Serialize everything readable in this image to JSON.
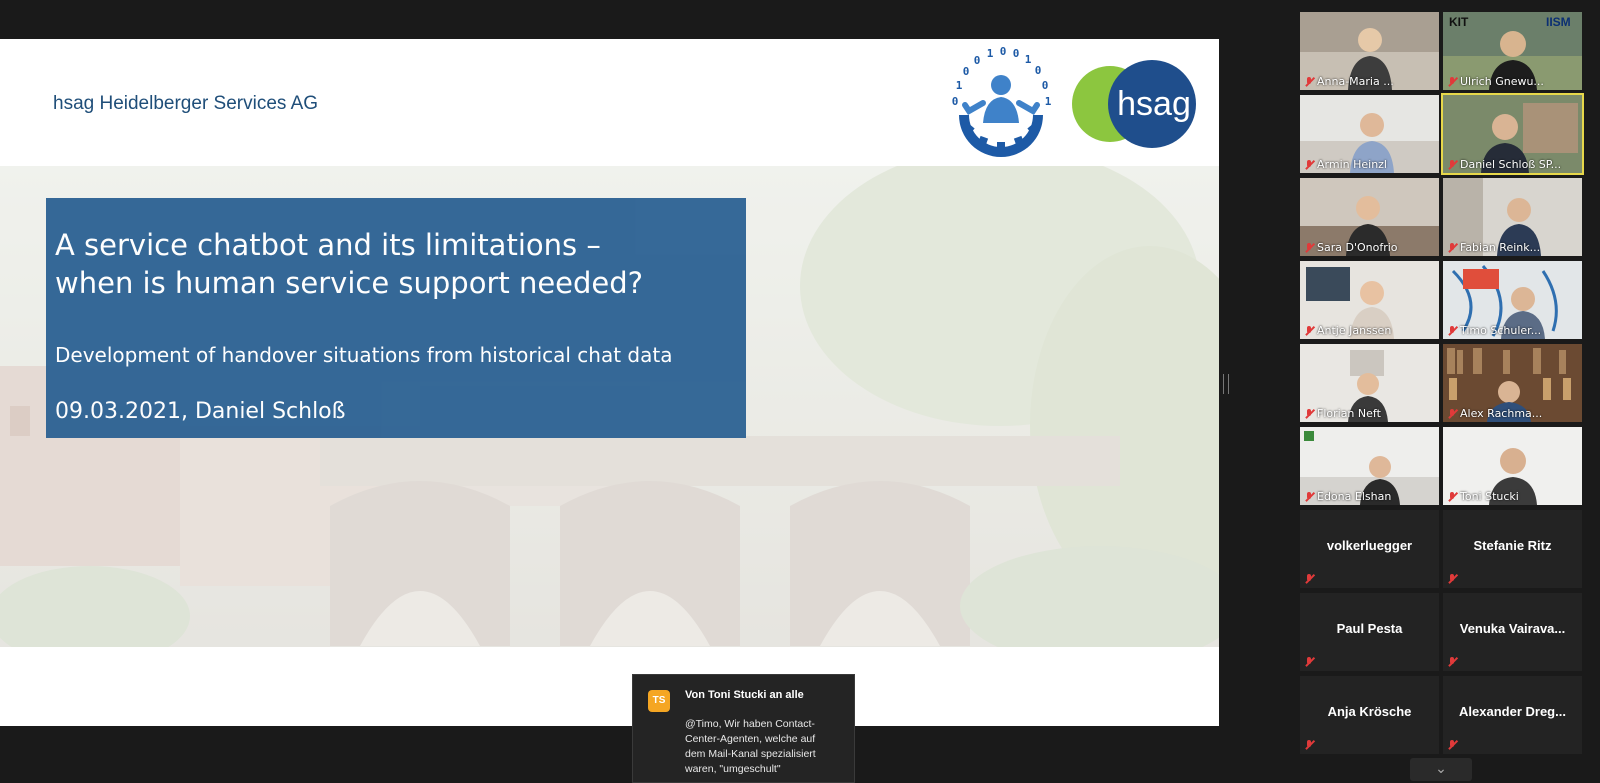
{
  "slide": {
    "company": "hsag Heidelberger Services AG",
    "logo_text": "hsag",
    "title_line1": "A service chatbot and its limitations –",
    "title_line2": "when is human service support needed?",
    "subtitle": "Development of handover situations from historical chat data",
    "date_presenter": "09.03.2021, Daniel Schloß"
  },
  "participants": [
    {
      "name": "Anna-Maria ...",
      "video": true,
      "muted": true
    },
    {
      "name": "Ulrich Gnewu...",
      "video": true,
      "muted": true,
      "badges": [
        "KIT",
        "IISM"
      ]
    },
    {
      "name": "Armin Heinzl",
      "video": true,
      "muted": true
    },
    {
      "name": "Daniel Schloß SP...",
      "video": true,
      "muted": false,
      "active_speaker": true
    },
    {
      "name": "Sara D'Onofrio",
      "video": true,
      "muted": true
    },
    {
      "name": "Fabian Reink...",
      "video": true,
      "muted": true
    },
    {
      "name": "Antje Janssen",
      "video": true,
      "muted": true
    },
    {
      "name": "Timo Schuler...",
      "video": true,
      "muted": true
    },
    {
      "name": "Florian Neft",
      "video": true,
      "muted": true
    },
    {
      "name": "Alex Rachma...",
      "video": true,
      "muted": true
    },
    {
      "name": "Edona Elshan",
      "video": true,
      "muted": true
    },
    {
      "name": "Toni Stucki",
      "video": true,
      "muted": true
    },
    {
      "name": "volkerluegger",
      "video": false,
      "muted": true
    },
    {
      "name": "Stefanie Ritz",
      "video": false,
      "muted": true
    },
    {
      "name": "Paul Pesta",
      "video": false,
      "muted": true
    },
    {
      "name": "Venuka  Vairava...",
      "video": false,
      "muted": true
    },
    {
      "name": "Anja Krösche",
      "video": false,
      "muted": true
    },
    {
      "name": "Alexander  Dreg...",
      "video": false,
      "muted": true
    }
  ],
  "chat": {
    "avatar_initials": "TS",
    "from": "Von Toni Stucki an alle",
    "message": "@Timo, Wir haben Contact-Center-Agenten, welche auf dem Mail-Kanal spezialisiert waren, \"umgeschult\""
  },
  "colors": {
    "slide_title_bg": "#2e6394",
    "company_text": "#1f4e79",
    "active_speaker_border": "#e7d84a",
    "muted_mic": "#e03a3a",
    "chat_avatar": "#f5a623"
  },
  "icons": {
    "muted": "mic-muted-icon",
    "scroll": "chevron-down-icon"
  }
}
